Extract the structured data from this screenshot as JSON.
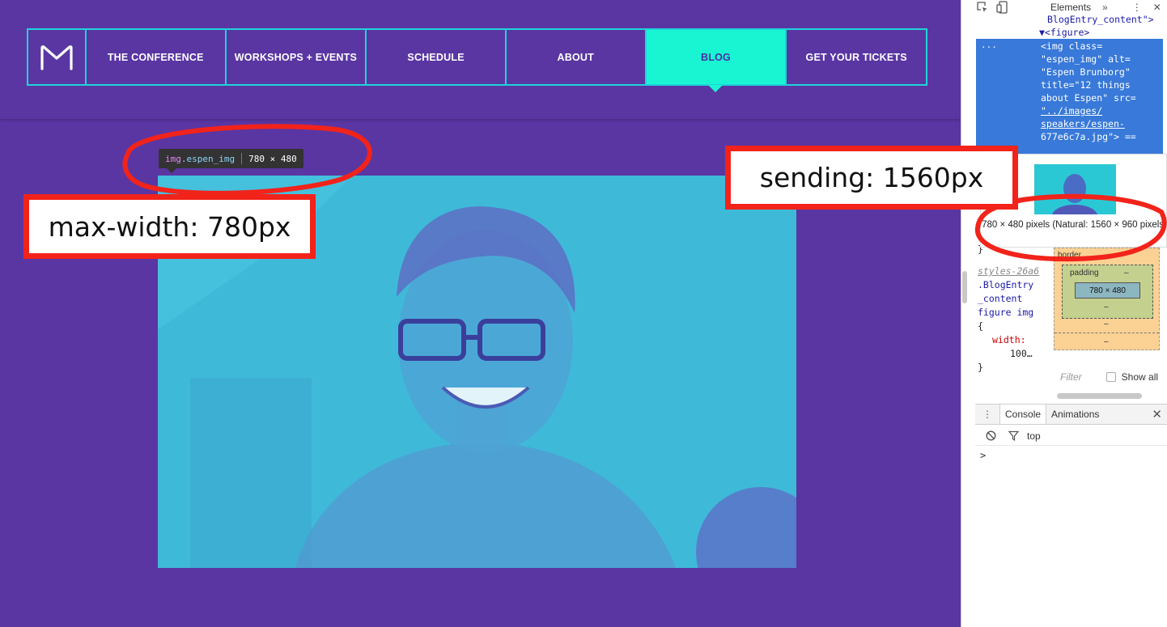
{
  "site": {
    "logo_icon": "conference-logo-icon",
    "nav": {
      "items": [
        {
          "label": "THE CONFERENCE",
          "active": false
        },
        {
          "label": "WORKSHOPS + EVENTS",
          "active": false
        },
        {
          "label": "SCHEDULE",
          "active": false
        },
        {
          "label": "ABOUT",
          "active": false
        },
        {
          "label": "BLOG",
          "active": true
        },
        {
          "label": "GET YOUR TICKETS",
          "active": false
        }
      ]
    },
    "image": {
      "alt": "Espen Brunborg",
      "title": "12 things about Espen"
    }
  },
  "inspector_tooltip": {
    "tag": "img",
    "class_name": ".espen_img",
    "size": "780 × 480"
  },
  "annotations": {
    "max_width": "max-width: 780px",
    "sending": "sending: 1560px"
  },
  "devtools": {
    "toolbar": {
      "tab": "Elements",
      "more": "»",
      "menu": "⋮",
      "close": "✕"
    },
    "dom": {
      "line_top": "BlogEntry_content\">",
      "line_figure": "▼<figure>",
      "selected_lines": [
        "<img class=",
        "\"espen_img\" alt=",
        "\"Espen Brunborg\"",
        "title=\"12 things",
        "about Espen\" src=",
        "\"../images/",
        "speakers/espen-",
        "677e6c7a.jpg\"> =="
      ],
      "dots": "..."
    },
    "image_preview": {
      "dims": "780 × 480 pixels (Natural: 1560 × 960 pixels)"
    },
    "styles": {
      "lines": [
        "}",
        "styles-26a6",
        ".BlogEntry",
        "_content",
        "figure img",
        "{",
        "width:",
        "100…",
        "}"
      ]
    },
    "box_model": {
      "border": "border",
      "padding": "padding",
      "dash": "–",
      "content": "780 × 480"
    },
    "filter": {
      "placeholder": "Filter",
      "show_all": "Show all"
    },
    "console": {
      "tabs": [
        "Console",
        "Animations"
      ],
      "context": "top",
      "prompt": ">"
    }
  }
}
